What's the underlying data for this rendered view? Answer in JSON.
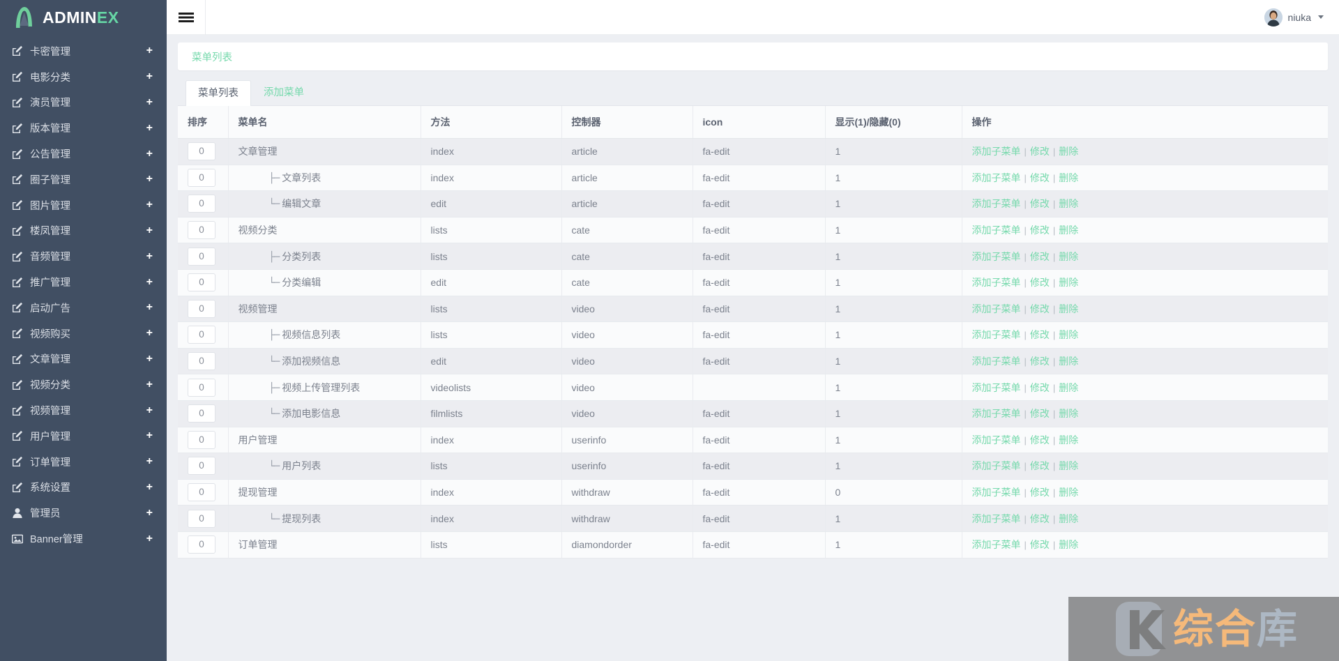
{
  "brand": {
    "name_dark": "ADMIN",
    "name_accent": "EX",
    "logo_icon": "adminex-logo-icon"
  },
  "sidebar": {
    "items": [
      {
        "label": "卡密管理",
        "icon": "edit-icon",
        "expand": "+"
      },
      {
        "label": "电影分类",
        "icon": "edit-icon",
        "expand": "+"
      },
      {
        "label": "演员管理",
        "icon": "edit-icon",
        "expand": "+"
      },
      {
        "label": "版本管理",
        "icon": "edit-icon",
        "expand": "+"
      },
      {
        "label": "公告管理",
        "icon": "edit-icon",
        "expand": "+"
      },
      {
        "label": "圈子管理",
        "icon": "edit-icon",
        "expand": "+"
      },
      {
        "label": "图片管理",
        "icon": "edit-icon",
        "expand": "+"
      },
      {
        "label": "楼凤管理",
        "icon": "edit-icon",
        "expand": "+"
      },
      {
        "label": "音频管理",
        "icon": "edit-icon",
        "expand": "+"
      },
      {
        "label": "推广管理",
        "icon": "edit-icon",
        "expand": "+"
      },
      {
        "label": "启动广告",
        "icon": "edit-icon",
        "expand": "+"
      },
      {
        "label": "视频购买",
        "icon": "edit-icon",
        "expand": "+"
      },
      {
        "label": "文章管理",
        "icon": "edit-icon",
        "expand": "+"
      },
      {
        "label": "视频分类",
        "icon": "edit-icon",
        "expand": "+"
      },
      {
        "label": "视频管理",
        "icon": "edit-icon",
        "expand": "+"
      },
      {
        "label": "用户管理",
        "icon": "edit-icon",
        "expand": "+"
      },
      {
        "label": "订单管理",
        "icon": "edit-icon",
        "expand": "+"
      },
      {
        "label": "系统设置",
        "icon": "edit-icon",
        "expand": "+"
      },
      {
        "label": "管理员",
        "icon": "user-icon",
        "expand": "+"
      },
      {
        "label": "Banner管理",
        "icon": "image-icon",
        "expand": "+"
      }
    ]
  },
  "topbar": {
    "menu_toggle_icon": "hamburger-icon",
    "user_name": "niuka",
    "avatar_icon": "avatar",
    "caret_icon": "chevron-down-icon"
  },
  "breadcrumb": {
    "label": "菜单列表"
  },
  "tabs": [
    {
      "label": "菜单列表",
      "active": true
    },
    {
      "label": "添加菜单",
      "active": false
    }
  ],
  "table": {
    "columns": [
      "排序",
      "菜单名",
      "方法",
      "控制器",
      "icon",
      "显示(1)/隐藏(0)",
      "操作"
    ],
    "actions": {
      "add_sub": "添加子菜单",
      "edit": "修改",
      "delete": "删除",
      "separator": "|"
    },
    "rows": [
      {
        "sort": "0",
        "tree": "",
        "name": "文章管理",
        "method": "index",
        "controller": "article",
        "icon": "fa-edit",
        "show": "1"
      },
      {
        "sort": "0",
        "tree": "├─",
        "name": "文章列表",
        "method": "index",
        "controller": "article",
        "icon": "fa-edit",
        "show": "1"
      },
      {
        "sort": "0",
        "tree": "└─",
        "name": "编辑文章",
        "method": "edit",
        "controller": "article",
        "icon": "fa-edit",
        "show": "1"
      },
      {
        "sort": "0",
        "tree": "",
        "name": "视频分类",
        "method": "lists",
        "controller": "cate",
        "icon": "fa-edit",
        "show": "1"
      },
      {
        "sort": "0",
        "tree": "├─",
        "name": "分类列表",
        "method": "lists",
        "controller": "cate",
        "icon": "fa-edit",
        "show": "1"
      },
      {
        "sort": "0",
        "tree": "└─",
        "name": "分类编辑",
        "method": "edit",
        "controller": "cate",
        "icon": "fa-edit",
        "show": "1"
      },
      {
        "sort": "0",
        "tree": "",
        "name": "视频管理",
        "method": "lists",
        "controller": "video",
        "icon": "fa-edit",
        "show": "1"
      },
      {
        "sort": "0",
        "tree": "├─",
        "name": "视频信息列表",
        "method": "lists",
        "controller": "video",
        "icon": "fa-edit",
        "show": "1"
      },
      {
        "sort": "0",
        "tree": "└─",
        "name": "添加视频信息",
        "method": "edit",
        "controller": "video",
        "icon": "fa-edit",
        "show": "1"
      },
      {
        "sort": "0",
        "tree": "├─",
        "name": "视频上传管理列表",
        "method": "videolists",
        "controller": "video",
        "icon": "",
        "show": "1"
      },
      {
        "sort": "0",
        "tree": "└─",
        "name": "添加电影信息",
        "method": "filmlists",
        "controller": "video",
        "icon": "fa-edit",
        "show": "1"
      },
      {
        "sort": "0",
        "tree": "",
        "name": "用户管理",
        "method": "index",
        "controller": "userinfo",
        "icon": "fa-edit",
        "show": "1"
      },
      {
        "sort": "0",
        "tree": "└─",
        "name": "用户列表",
        "method": "lists",
        "controller": "userinfo",
        "icon": "fa-edit",
        "show": "1"
      },
      {
        "sort": "0",
        "tree": "",
        "name": "提现管理",
        "method": "index",
        "controller": "withdraw",
        "icon": "fa-edit",
        "show": "0"
      },
      {
        "sort": "0",
        "tree": "└─",
        "name": "提现列表",
        "method": "index",
        "controller": "withdraw",
        "icon": "fa-edit",
        "show": "1"
      },
      {
        "sort": "0",
        "tree": "",
        "name": "订单管理",
        "method": "lists",
        "controller": "diamondorder",
        "icon": "fa-edit",
        "show": "1"
      }
    ]
  },
  "watermark": {
    "logo_icon": "k-logo-icon",
    "text_orange": "综合",
    "text_grey": "库"
  },
  "colors": {
    "sidebar_bg": "#414f63",
    "accent_green": "#76d9ac",
    "row_odd": "#ecedf1",
    "row_even": "#fafbfc",
    "text": "#7b818d"
  }
}
